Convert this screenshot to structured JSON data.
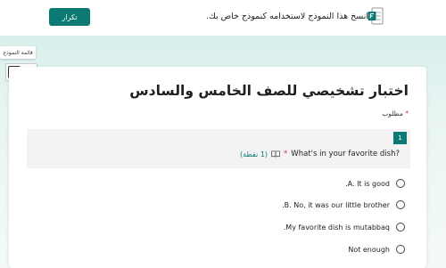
{
  "topbar": {
    "duplicate_button": "تكرار",
    "duplicate_message": "انسخ هذا النموذج لاستخدامه كنموذج خاص بك."
  },
  "sidebar": {
    "tooltip": "قائمة النموذج"
  },
  "form": {
    "title": "اختبار تشخيصي للصف الخامس والسادس",
    "required_label": "مطلوب",
    "question": {
      "number": "1",
      "text": "What's in your favorite dish?",
      "points": "(1 نقطة)",
      "options": [
        ".A. It is good",
        ".B. No, it was our little brother",
        ".My favorite dish is mutabbaq",
        "Not enough"
      ]
    }
  },
  "colors": {
    "accent": "#0b7a75",
    "required": "#c4314b"
  },
  "icons": {
    "forms_logo": "forms-icon",
    "more": "more-icon",
    "immersive_reader": "immersive-reader-icon"
  }
}
